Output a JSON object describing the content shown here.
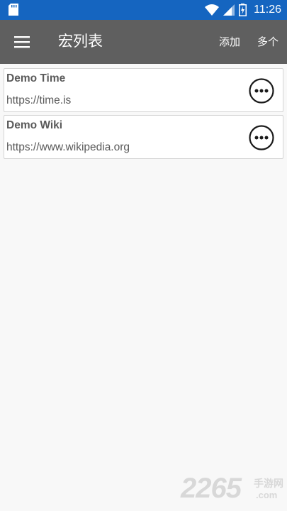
{
  "status_bar": {
    "time": "11:26",
    "icons": [
      "sd-card-icon",
      "wifi-icon",
      "signal-icon",
      "battery-charging-icon"
    ]
  },
  "app_bar": {
    "title": "宏列表",
    "add_label": "添加",
    "multi_label": "多个",
    "menu_icon": "hamburger-menu-icon"
  },
  "macros": [
    {
      "title": "Demo Time",
      "url": "https://time.is"
    },
    {
      "title": "Demo Wiki",
      "url": "https://www.wikipedia.org"
    }
  ],
  "watermark": {
    "number": "2265",
    "site": "手游网",
    "domain": ".com"
  },
  "colors": {
    "status_bar": "#1565c0",
    "app_bar": "#5f5f5f",
    "background": "#f8f8f8",
    "card_text": "#5a5a5a"
  }
}
